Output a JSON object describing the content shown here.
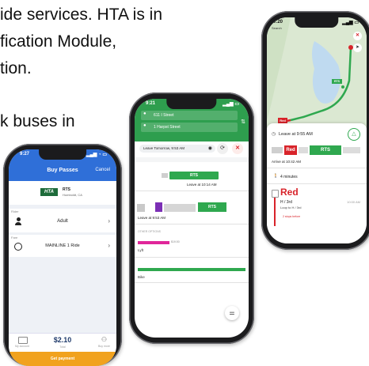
{
  "slide": {
    "line1": "ide services. HTA is in",
    "line2": "fication Module,",
    "line3": "tion.",
    "line4": "k buses in"
  },
  "phone_left": {
    "time": "9:27",
    "title": "Buy Passes",
    "cancel": "Cancel",
    "agency_logo": "HTA",
    "agency_name": "RTS",
    "agency_sub": "Humboldt, CA",
    "rider_label": "Rider",
    "rider_value": "Adult",
    "fare_label": "Fare",
    "fare_value": "MAINLINE 1 Ride",
    "price": "$2.10",
    "total_label": "Total",
    "left_label": "My account",
    "right_label": "Buy more",
    "pay_button": "Get payment"
  },
  "phone_mid": {
    "time": "9:21",
    "from": "611 I Street",
    "to": "1 Harpst Street",
    "leave_text": "Leave Tomorrow, 9:53 AM",
    "route_a": "RTS",
    "leave_a": "Leave at 10:14 AM",
    "route_b": "RTS",
    "leave_b": "Leave at 9:53 AM",
    "other_options": "OTHER OPTIONS",
    "lyft": "Lyft",
    "lyft_price": "$19.50",
    "bike": "Bike",
    "colors": {
      "green": "#2fa84f",
      "purple": "#7b2fb5",
      "pink": "#e0269a"
    }
  },
  "phone_right": {
    "time": "9:20",
    "back": "Search",
    "leave_text": "Leave at 9:55 AM",
    "route_red": "Red",
    "route_rts": "RTS",
    "arrive_text": "Arrive at 10:42 AM",
    "walk_text": "4 minutes",
    "line_name": "Red",
    "stop_name": "H / 3rd",
    "stop_sub": "Loop to H / 3rd",
    "stop_time": "10:00 AM",
    "stops_before": "2 stops before",
    "colors": {
      "red": "#d8232a",
      "green": "#2fa84f",
      "map": "#dbe8d2",
      "water": "#bfdaf0"
    }
  }
}
